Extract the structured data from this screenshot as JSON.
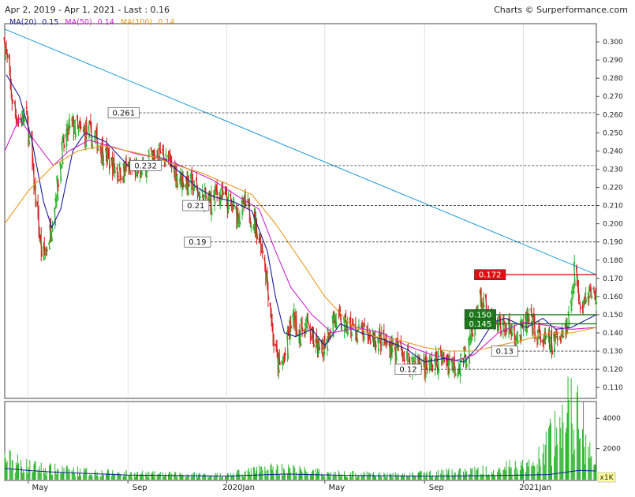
{
  "header": {
    "range_label": "Apr 2, 2019 - Apr 1, 2021 - Last : 0.16",
    "credit": "Charts © Surperformance.com"
  },
  "chart_data": {
    "type": "candlestick",
    "price_axis": {
      "range": [
        0.104,
        0.31
      ],
      "ticks": [
        "0.110",
        "0.120",
        "0.130",
        "0.140",
        "0.150",
        "0.160",
        "0.170",
        "0.180",
        "0.190",
        "0.200",
        "0.210",
        "0.220",
        "0.230",
        "0.240",
        "0.250",
        "0.260",
        "0.270",
        "0.280",
        "0.290",
        "0.300"
      ],
      "tick_values": [
        0.11,
        0.12,
        0.13,
        0.14,
        0.15,
        0.16,
        0.17,
        0.18,
        0.19,
        0.2,
        0.21,
        0.22,
        0.23,
        0.24,
        0.25,
        0.26,
        0.27,
        0.28,
        0.29,
        0.3
      ]
    },
    "volume_axis": {
      "range": [
        0,
        5000
      ],
      "ticks": [
        "2000",
        "4000"
      ],
      "tick_values": [
        2000,
        4000
      ],
      "unit_label": "x1K"
    },
    "time_axis": {
      "start": "2019-04-02",
      "end": "2021-04-01",
      "labels": [
        "May",
        "Sep",
        "2020Jan",
        "May",
        "Sep",
        "2021Jan"
      ],
      "label_dates": [
        "2019-05-01",
        "2019-09-01",
        "2020-01-01",
        "2020-05-01",
        "2020-09-01",
        "2021-01-01"
      ]
    },
    "legend": [
      {
        "name": "MA(20)",
        "value": "0.15",
        "color": "#1a1aa0"
      },
      {
        "name": "MA(50)",
        "value": "0.14",
        "color": "#cc22cc"
      },
      {
        "name": "MA(100)",
        "value": "0.14",
        "color": "#e89a1c"
      }
    ],
    "candle_colors": {
      "up": "#2cb52c",
      "down": "#d42020"
    },
    "volume_color": "#2cb52c",
    "trendline": {
      "start": [
        "2019-04-02",
        0.307
      ],
      "end": [
        "2021-04-01",
        0.172
      ],
      "color": "#1a9ad6"
    },
    "levels": [
      {
        "label": "0.261",
        "value": 0.261,
        "start": "2019-09-15",
        "style": "dashed",
        "box": "white"
      },
      {
        "label": "0.232",
        "value": 0.232,
        "start": "2019-10-12",
        "style": "dashed",
        "box": "white"
      },
      {
        "label": "0.21",
        "value": 0.21,
        "start": "2019-12-10",
        "style": "dashed",
        "box": "white"
      },
      {
        "label": "0.19",
        "value": 0.19,
        "start": "2019-12-12",
        "style": "dashed",
        "box": "white"
      },
      {
        "label": "0.172",
        "value": 0.172,
        "start": "2020-12-10",
        "style": "solid",
        "box": "red"
      },
      {
        "label": "0.150",
        "value": 0.15,
        "start": "2020-11-28",
        "style": "solid",
        "box": "green"
      },
      {
        "label": "0.145",
        "value": 0.145,
        "start": "2020-11-28",
        "style": "solid",
        "box": "green"
      },
      {
        "label": "0.13",
        "value": 0.13,
        "start": "2020-12-25",
        "style": "dashed",
        "box": "white"
      },
      {
        "label": "0.12",
        "value": 0.12,
        "start": "2020-08-28",
        "style": "dashed",
        "box": "white"
      }
    ],
    "price_anchors": [
      [
        "2019-04-02",
        0.3
      ],
      [
        "2019-04-06",
        0.285
      ],
      [
        "2019-04-12",
        0.265
      ],
      [
        "2019-04-20",
        0.255
      ],
      [
        "2019-04-28",
        0.262
      ],
      [
        "2019-05-04",
        0.24
      ],
      [
        "2019-05-12",
        0.205
      ],
      [
        "2019-05-18",
        0.18
      ],
      [
        "2019-05-26",
        0.19
      ],
      [
        "2019-06-04",
        0.215
      ],
      [
        "2019-06-12",
        0.24
      ],
      [
        "2019-06-22",
        0.255
      ],
      [
        "2019-07-02",
        0.25
      ],
      [
        "2019-07-14",
        0.25
      ],
      [
        "2019-07-26",
        0.245
      ],
      [
        "2019-08-08",
        0.235
      ],
      [
        "2019-08-20",
        0.228
      ],
      [
        "2019-09-01",
        0.23
      ],
      [
        "2019-09-15",
        0.228
      ],
      [
        "2019-09-28",
        0.235
      ],
      [
        "2019-10-10",
        0.24
      ],
      [
        "2019-10-22",
        0.233
      ],
      [
        "2019-11-05",
        0.225
      ],
      [
        "2019-11-18",
        0.222
      ],
      [
        "2019-11-30",
        0.215
      ],
      [
        "2019-12-10",
        0.212
      ],
      [
        "2019-12-22",
        0.218
      ],
      [
        "2020-01-03",
        0.21
      ],
      [
        "2020-01-15",
        0.206
      ],
      [
        "2020-01-25",
        0.21
      ],
      [
        "2020-02-05",
        0.2
      ],
      [
        "2020-02-15",
        0.185
      ],
      [
        "2020-02-22",
        0.16
      ],
      [
        "2020-02-29",
        0.13
      ],
      [
        "2020-03-06",
        0.12
      ],
      [
        "2020-03-13",
        0.128
      ],
      [
        "2020-03-22",
        0.15
      ],
      [
        "2020-03-30",
        0.14
      ],
      [
        "2020-04-08",
        0.145
      ],
      [
        "2020-04-17",
        0.135
      ],
      [
        "2020-04-26",
        0.128
      ],
      [
        "2020-05-04",
        0.14
      ],
      [
        "2020-05-12",
        0.148
      ],
      [
        "2020-05-22",
        0.145
      ],
      [
        "2020-06-03",
        0.142
      ],
      [
        "2020-06-15",
        0.14
      ],
      [
        "2020-06-27",
        0.138
      ],
      [
        "2020-07-10",
        0.135
      ],
      [
        "2020-07-22",
        0.132
      ],
      [
        "2020-08-03",
        0.13
      ],
      [
        "2020-08-15",
        0.125
      ],
      [
        "2020-08-27",
        0.123
      ],
      [
        "2020-09-08",
        0.122
      ],
      [
        "2020-09-20",
        0.126
      ],
      [
        "2020-10-02",
        0.125
      ],
      [
        "2020-10-12",
        0.122
      ],
      [
        "2020-10-22",
        0.128
      ],
      [
        "2020-10-30",
        0.138
      ],
      [
        "2020-11-08",
        0.16
      ],
      [
        "2020-11-15",
        0.15
      ],
      [
        "2020-11-25",
        0.143
      ],
      [
        "2020-12-05",
        0.145
      ],
      [
        "2020-12-15",
        0.142
      ],
      [
        "2020-12-25",
        0.138
      ],
      [
        "2021-01-05",
        0.146
      ],
      [
        "2021-01-15",
        0.142
      ],
      [
        "2021-01-25",
        0.135
      ],
      [
        "2021-02-05",
        0.133
      ],
      [
        "2021-02-15",
        0.14
      ],
      [
        "2021-02-25",
        0.145
      ],
      [
        "2021-03-05",
        0.175
      ],
      [
        "2021-03-12",
        0.158
      ],
      [
        "2021-03-20",
        0.162
      ],
      [
        "2021-04-01",
        0.16
      ]
    ],
    "ma_series": [
      {
        "name": "MA(20)",
        "color": "#1a1aa0",
        "points": [
          [
            "2019-04-04",
            0.282
          ],
          [
            "2019-04-20",
            0.27
          ],
          [
            "2019-05-05",
            0.247
          ],
          [
            "2019-05-20",
            0.212
          ],
          [
            "2019-05-30",
            0.198
          ],
          [
            "2019-06-10",
            0.208
          ],
          [
            "2019-06-25",
            0.24
          ],
          [
            "2019-07-10",
            0.25
          ],
          [
            "2019-08-05",
            0.245
          ],
          [
            "2019-09-01",
            0.232
          ],
          [
            "2019-09-20",
            0.23
          ],
          [
            "2019-10-15",
            0.236
          ],
          [
            "2019-11-05",
            0.228
          ],
          [
            "2019-11-25",
            0.22
          ],
          [
            "2019-12-15",
            0.215
          ],
          [
            "2020-01-10",
            0.212
          ],
          [
            "2020-02-01",
            0.207
          ],
          [
            "2020-02-20",
            0.185
          ],
          [
            "2020-03-01",
            0.16
          ],
          [
            "2020-03-12",
            0.14
          ],
          [
            "2020-03-26",
            0.138
          ],
          [
            "2020-04-15",
            0.142
          ],
          [
            "2020-05-01",
            0.133
          ],
          [
            "2020-05-20",
            0.145
          ],
          [
            "2020-06-15",
            0.14
          ],
          [
            "2020-07-15",
            0.136
          ],
          [
            "2020-08-10",
            0.131
          ],
          [
            "2020-09-01",
            0.124
          ],
          [
            "2020-09-25",
            0.126
          ],
          [
            "2020-10-20",
            0.124
          ],
          [
            "2020-11-05",
            0.132
          ],
          [
            "2020-11-25",
            0.146
          ],
          [
            "2020-12-10",
            0.148
          ],
          [
            "2021-01-05",
            0.143
          ],
          [
            "2021-01-25",
            0.148
          ],
          [
            "2021-02-10",
            0.142
          ],
          [
            "2021-03-01",
            0.143
          ],
          [
            "2021-04-01",
            0.15
          ]
        ]
      },
      {
        "name": "MA(50)",
        "color": "#cc22cc",
        "points": [
          [
            "2019-04-02",
            0.24
          ],
          [
            "2019-04-20",
            0.258
          ],
          [
            "2019-05-10",
            0.245
          ],
          [
            "2019-06-01",
            0.232
          ],
          [
            "2019-06-20",
            0.24
          ],
          [
            "2019-07-15",
            0.246
          ],
          [
            "2019-08-15",
            0.242
          ],
          [
            "2019-09-15",
            0.238
          ],
          [
            "2019-10-15",
            0.236
          ],
          [
            "2019-11-15",
            0.23
          ],
          [
            "2019-12-15",
            0.224
          ],
          [
            "2020-01-15",
            0.215
          ],
          [
            "2020-02-10",
            0.208
          ],
          [
            "2020-03-01",
            0.185
          ],
          [
            "2020-03-20",
            0.165
          ],
          [
            "2020-04-15",
            0.15
          ],
          [
            "2020-05-10",
            0.14
          ],
          [
            "2020-06-10",
            0.143
          ],
          [
            "2020-07-10",
            0.14
          ],
          [
            "2020-08-10",
            0.133
          ],
          [
            "2020-09-10",
            0.128
          ],
          [
            "2020-10-10",
            0.125
          ],
          [
            "2020-11-01",
            0.128
          ],
          [
            "2020-12-01",
            0.14
          ],
          [
            "2021-01-01",
            0.146
          ],
          [
            "2021-02-01",
            0.144
          ],
          [
            "2021-03-01",
            0.142
          ],
          [
            "2021-04-01",
            0.143
          ]
        ]
      },
      {
        "name": "MA(100)",
        "color": "#e89a1c",
        "points": [
          [
            "2019-04-02",
            0.2
          ],
          [
            "2019-05-01",
            0.218
          ],
          [
            "2019-06-01",
            0.232
          ],
          [
            "2019-07-01",
            0.24
          ],
          [
            "2019-08-01",
            0.243
          ],
          [
            "2019-09-01",
            0.24
          ],
          [
            "2019-10-01",
            0.237
          ],
          [
            "2019-11-01",
            0.232
          ],
          [
            "2019-12-01",
            0.228
          ],
          [
            "2020-01-01",
            0.222
          ],
          [
            "2020-02-01",
            0.216
          ],
          [
            "2020-03-01",
            0.2
          ],
          [
            "2020-04-01",
            0.18
          ],
          [
            "2020-05-01",
            0.16
          ],
          [
            "2020-06-01",
            0.145
          ],
          [
            "2020-07-01",
            0.138
          ],
          [
            "2020-08-01",
            0.136
          ],
          [
            "2020-09-01",
            0.132
          ],
          [
            "2020-10-01",
            0.13
          ],
          [
            "2020-11-01",
            0.13
          ],
          [
            "2020-12-01",
            0.133
          ],
          [
            "2021-01-01",
            0.136
          ],
          [
            "2021-02-01",
            0.14
          ],
          [
            "2021-03-01",
            0.14
          ],
          [
            "2021-04-01",
            0.143
          ]
        ]
      }
    ],
    "volume_anchors": [
      [
        "2019-04-02",
        1300
      ],
      [
        "2019-05-01",
        800
      ],
      [
        "2019-06-01",
        600
      ],
      [
        "2019-08-01",
        400
      ],
      [
        "2019-10-01",
        300
      ],
      [
        "2020-01-01",
        250
      ],
      [
        "2020-03-01",
        700
      ],
      [
        "2020-05-01",
        350
      ],
      [
        "2020-08-01",
        250
      ],
      [
        "2020-11-01",
        500
      ],
      [
        "2021-01-15",
        900
      ],
      [
        "2021-03-05",
        4800
      ],
      [
        "2021-04-01",
        400
      ]
    ],
    "volume_ma": [
      [
        "2019-04-02",
        700
      ],
      [
        "2019-05-01",
        550
      ],
      [
        "2019-06-01",
        450
      ],
      [
        "2019-09-01",
        250
      ],
      [
        "2020-01-01",
        180
      ],
      [
        "2020-03-15",
        320
      ],
      [
        "2020-06-01",
        220
      ],
      [
        "2020-09-01",
        180
      ],
      [
        "2020-12-01",
        220
      ],
      [
        "2021-02-01",
        280
      ],
      [
        "2021-03-10",
        550
      ],
      [
        "2021-04-01",
        520
      ]
    ],
    "volume_ma_color": "#1a1aa0"
  }
}
